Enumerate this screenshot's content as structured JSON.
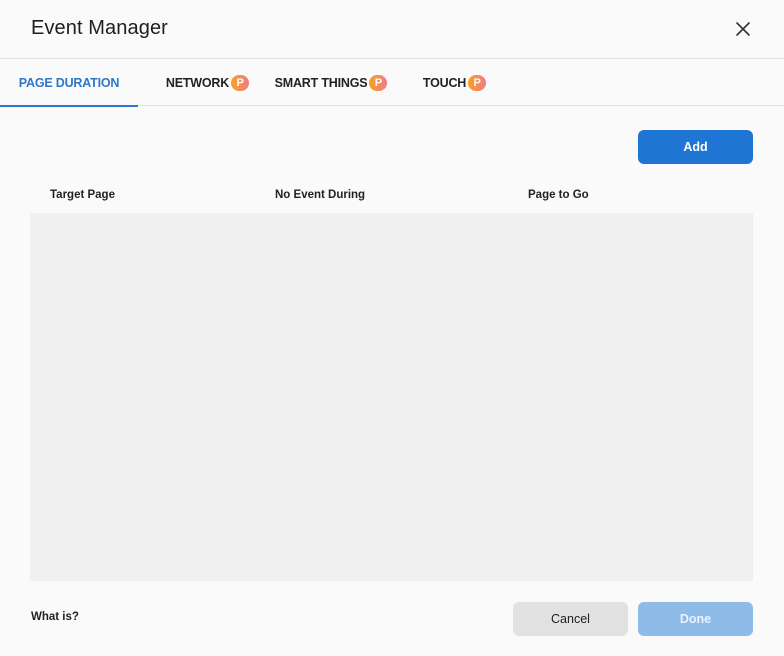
{
  "dialog": {
    "title": "Event Manager",
    "close_icon": "close-icon"
  },
  "tabs": [
    {
      "label": "PAGE DURATION",
      "active": true,
      "badge": ""
    },
    {
      "label": "NETWORK",
      "active": false,
      "badge": "P"
    },
    {
      "label": "SMART THINGS",
      "active": false,
      "badge": "P"
    },
    {
      "label": "TOUCH",
      "active": false,
      "badge": "P"
    }
  ],
  "toolbar": {
    "add_label": "Add"
  },
  "table": {
    "columns": [
      "Target Page",
      "No Event During",
      "Page to Go"
    ],
    "rows": []
  },
  "footer": {
    "help_link": "What is?",
    "cancel_label": "Cancel",
    "done_label": "Done"
  },
  "colors": {
    "accent": "#1f75d4",
    "accent_disabled": "#8fbbe9",
    "active_tab": "#2e78cc",
    "badge_gradient": [
      "#f6a21c",
      "#f27a8a"
    ]
  }
}
